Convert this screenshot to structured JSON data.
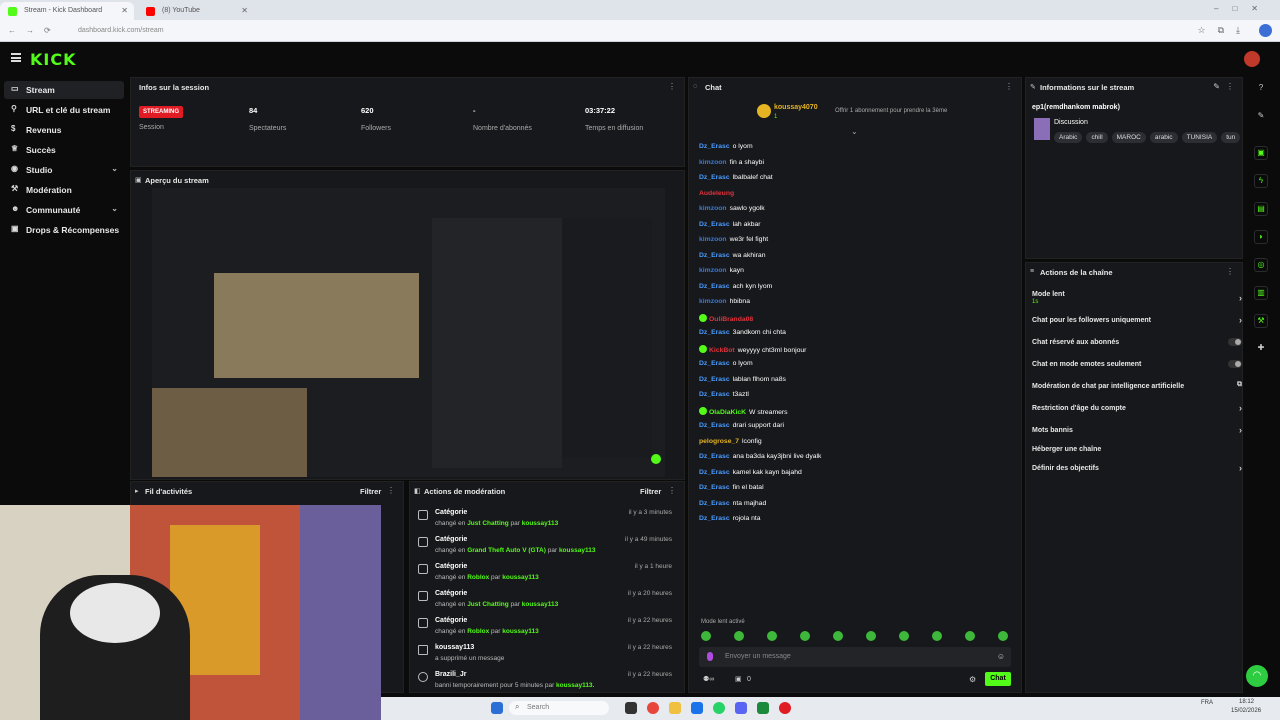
{
  "browser": {
    "tabs": [
      {
        "label": "Stream - Kick Dashboard"
      },
      {
        "label": "(8) YouTube"
      }
    ],
    "url": "dashboard.kick.com/stream"
  },
  "app": {
    "logo": "KICK"
  },
  "sidebar": {
    "items": [
      {
        "label": "Stream",
        "icon": "stream-icon"
      },
      {
        "label": "URL et clé du stream",
        "icon": "key-icon"
      },
      {
        "label": "Revenus",
        "icon": "dollar-icon"
      },
      {
        "label": "Succès",
        "icon": "trophy-icon"
      },
      {
        "label": "Studio",
        "icon": "studio-icon"
      },
      {
        "label": "Modération",
        "icon": "gavel-icon"
      },
      {
        "label": "Communauté",
        "icon": "community-icon"
      },
      {
        "label": "Drops & Récompenses",
        "icon": "gift-icon"
      }
    ]
  },
  "session": {
    "title": "Infos sur la session",
    "status_badge": "STREAMING",
    "status_label": "Session",
    "stats": [
      {
        "value": "84",
        "label": "Spectateurs"
      },
      {
        "value": "620",
        "label": "Followers"
      },
      {
        "value": "-",
        "label": "Nombre d'abonnés"
      },
      {
        "value": "03:37:22",
        "label": "Temps en diffusion"
      }
    ]
  },
  "preview": {
    "title": "Aperçu du stream"
  },
  "activity": {
    "title": "Fil d'activités",
    "filter": "Filtrer"
  },
  "moderation": {
    "title": "Actions de modération",
    "filter": "Filtrer",
    "rows": [
      {
        "title": "Catégorie",
        "pre": "changé en",
        "target": "Just Chatting",
        "by": "par",
        "user": "koussay113",
        "time": "il y a 3 minutes"
      },
      {
        "title": "Catégorie",
        "pre": "changé en",
        "target": "Grand Theft Auto V (GTA)",
        "by": "par",
        "user": "koussay113",
        "time": "il y a 49 minutes"
      },
      {
        "title": "Catégorie",
        "pre": "changé en",
        "target": "Roblox",
        "by": "par",
        "user": "koussay113",
        "time": "il y a 1 heure"
      },
      {
        "title": "Catégorie",
        "pre": "changé en",
        "target": "Just Chatting",
        "by": "par",
        "user": "koussay113",
        "time": "il y a 20 heures"
      },
      {
        "title": "Catégorie",
        "pre": "changé en",
        "target": "Roblox",
        "by": "par",
        "user": "koussay113",
        "time": "il y a 22 heures"
      },
      {
        "title": "koussay113",
        "pre": "a supprimé un message",
        "target": "",
        "by": "",
        "user": "",
        "time": "il y a 22 heures"
      },
      {
        "title": "Brazili_Jr",
        "pre": "banni temporairement pour 5 minutes par",
        "target": "",
        "by": "",
        "user": "koussay113.",
        "time": "il y a 22 heures"
      }
    ]
  },
  "chat": {
    "title": "Chat",
    "pinned": {
      "user": "koussay4070",
      "count": "1",
      "text": "Offrir 1 abonnement pour prendre la 3ème"
    },
    "messages": [
      {
        "user": "Dz_Erasc",
        "text": "o lyom",
        "color": "#4a9cff",
        "badge": false
      },
      {
        "user": "kimzoon",
        "text": "fin a shaybi",
        "color": "#3a7bd5",
        "badge": false
      },
      {
        "user": "Dz_Erasc",
        "text": "lbalbalef chat",
        "color": "#4a9cff",
        "badge": false
      },
      {
        "user": "Audeleung",
        "text": "",
        "color": "#e0323c",
        "badge": false
      },
      {
        "user": "kimzoon",
        "text": "sawlo ygolk",
        "color": "#3a7bd5",
        "badge": false
      },
      {
        "user": "Dz_Erasc",
        "text": "lah akbar",
        "color": "#4a9cff",
        "badge": false
      },
      {
        "user": "kimzoon",
        "text": "we3r fel fight",
        "color": "#3a7bd5",
        "badge": false
      },
      {
        "user": "Dz_Erasc",
        "text": "wa akhiran",
        "color": "#4a9cff",
        "badge": false
      },
      {
        "user": "kimzoon",
        "text": "kayn",
        "color": "#3a7bd5",
        "badge": false
      },
      {
        "user": "Dz_Erasc",
        "text": "ach kyn lyom",
        "color": "#4a9cff",
        "badge": false
      },
      {
        "user": "kimzoon",
        "text": "hbibna",
        "color": "#3a7bd5",
        "badge": false
      },
      {
        "user": "OuliBranda08",
        "text": "",
        "color": "#e0323c",
        "badge": true
      },
      {
        "user": "Dz_Erasc",
        "text": "3andkom chi chta",
        "color": "#4a9cff",
        "badge": false
      },
      {
        "user": "KickBot",
        "text": "weyyyy cht3ml bonjour",
        "color": "#e0323c",
        "badge": true
      },
      {
        "user": "Dz_Erasc",
        "text": "o lyom",
        "color": "#4a9cff",
        "badge": false
      },
      {
        "user": "Dz_Erasc",
        "text": "lablan flhom na8s",
        "color": "#4a9cff",
        "badge": false
      },
      {
        "user": "Dz_Erasc",
        "text": "t3aztl",
        "color": "#4a9cff",
        "badge": false
      },
      {
        "user": "OlaDiaKicK",
        "text": "W streamers",
        "color": "#53fc18",
        "badge": true
      },
      {
        "user": "Dz_Erasc",
        "text": "drari support dari",
        "color": "#4a9cff",
        "badge": false
      },
      {
        "user": "pelogrose_7",
        "text": "lconfig",
        "color": "#e6b422",
        "badge": false
      },
      {
        "user": "Dz_Erasc",
        "text": "ana ba3da kay3jbni live dyalk",
        "color": "#4a9cff",
        "badge": false
      },
      {
        "user": "Dz_Erasc",
        "text": "kamel kak kayn bajahd",
        "color": "#4a9cff",
        "badge": false
      },
      {
        "user": "Dz_Erasc",
        "text": "fin el batal",
        "color": "#4a9cff",
        "badge": false
      },
      {
        "user": "Dz_Erasc",
        "text": "nta majhad",
        "color": "#4a9cff",
        "badge": false
      },
      {
        "user": "Dz_Erasc",
        "text": "rojola nta",
        "color": "#4a9cff",
        "badge": false
      }
    ],
    "slow_mode": "Mode lent activé",
    "input_placeholder": "Envoyer un message",
    "viewers_count": "0",
    "send_label": "Chat"
  },
  "stream_info": {
    "title": "Informations sur le stream",
    "stream_title": "ep1(remdhankom mabrok)",
    "category": "Discussion",
    "tags": [
      "Arabic",
      "chill",
      "MAROC",
      "arabic",
      "TUNISIA",
      "tun"
    ]
  },
  "channel_actions": {
    "title": "Actions de la chaîne",
    "slow_mode": {
      "label": "Mode lent",
      "value": "1s"
    },
    "items": [
      {
        "label": "Chat pour les followers uniquement",
        "control": "arrow"
      },
      {
        "label": "Chat réservé aux abonnés",
        "control": "toggle"
      },
      {
        "label": "Chat en mode emotes seulement",
        "control": "toggle"
      },
      {
        "label": "Modération de chat par intelligence artificielle",
        "control": "external"
      },
      {
        "label": "Restriction d'âge du compte",
        "control": "arrow"
      },
      {
        "label": "Mots bannis",
        "control": "arrow"
      },
      {
        "label": "Héberger une chaîne",
        "control": "none"
      },
      {
        "label": "Définir des objectifs",
        "control": "arrow"
      }
    ]
  },
  "taskbar": {
    "search": "Search",
    "lang": "FRA",
    "time": "18:12",
    "date": "15/02/2026"
  },
  "colors": {
    "accent": "#53fc18",
    "live": "#e01b24",
    "panel": "#17181b",
    "background": "#0b0b0c"
  }
}
